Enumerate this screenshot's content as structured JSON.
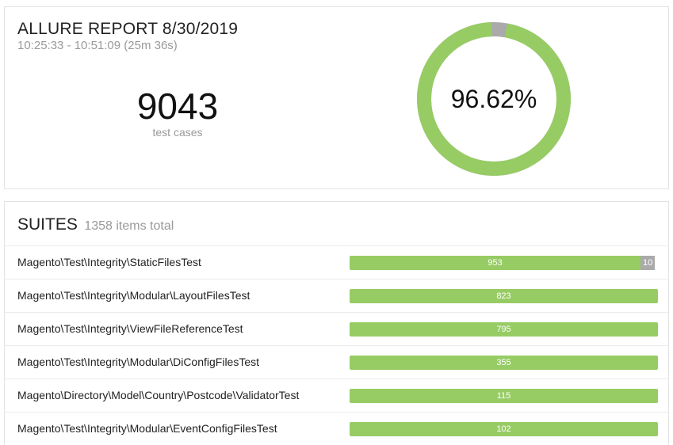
{
  "report": {
    "title": "ALLURE REPORT 8/30/2019",
    "time_range": "10:25:33 - 10:51:09 (25m 36s)",
    "total_count": "9043",
    "total_label": "test cases",
    "success_rate": "96.62%",
    "success_fraction": 0.9662
  },
  "colors": {
    "passed": "#97cc64",
    "unknown": "#aaaaaa"
  },
  "suites": {
    "title": "SUITES",
    "total_text": "1358 items total",
    "items": [
      {
        "name": "Magento\\Test\\Integrity\\StaticFilesTest",
        "passed": 953,
        "unknown": 10
      },
      {
        "name": "Magento\\Test\\Integrity\\Modular\\LayoutFilesTest",
        "passed": 823,
        "unknown": 0
      },
      {
        "name": "Magento\\Test\\Integrity\\ViewFileReferenceTest",
        "passed": 795,
        "unknown": 0
      },
      {
        "name": "Magento\\Test\\Integrity\\Modular\\DiConfigFilesTest",
        "passed": 355,
        "unknown": 0
      },
      {
        "name": "Magento\\Directory\\Model\\Country\\Postcode\\ValidatorTest",
        "passed": 115,
        "unknown": 0
      },
      {
        "name": "Magento\\Test\\Integrity\\Modular\\EventConfigFilesTest",
        "passed": 102,
        "unknown": 0
      }
    ]
  }
}
